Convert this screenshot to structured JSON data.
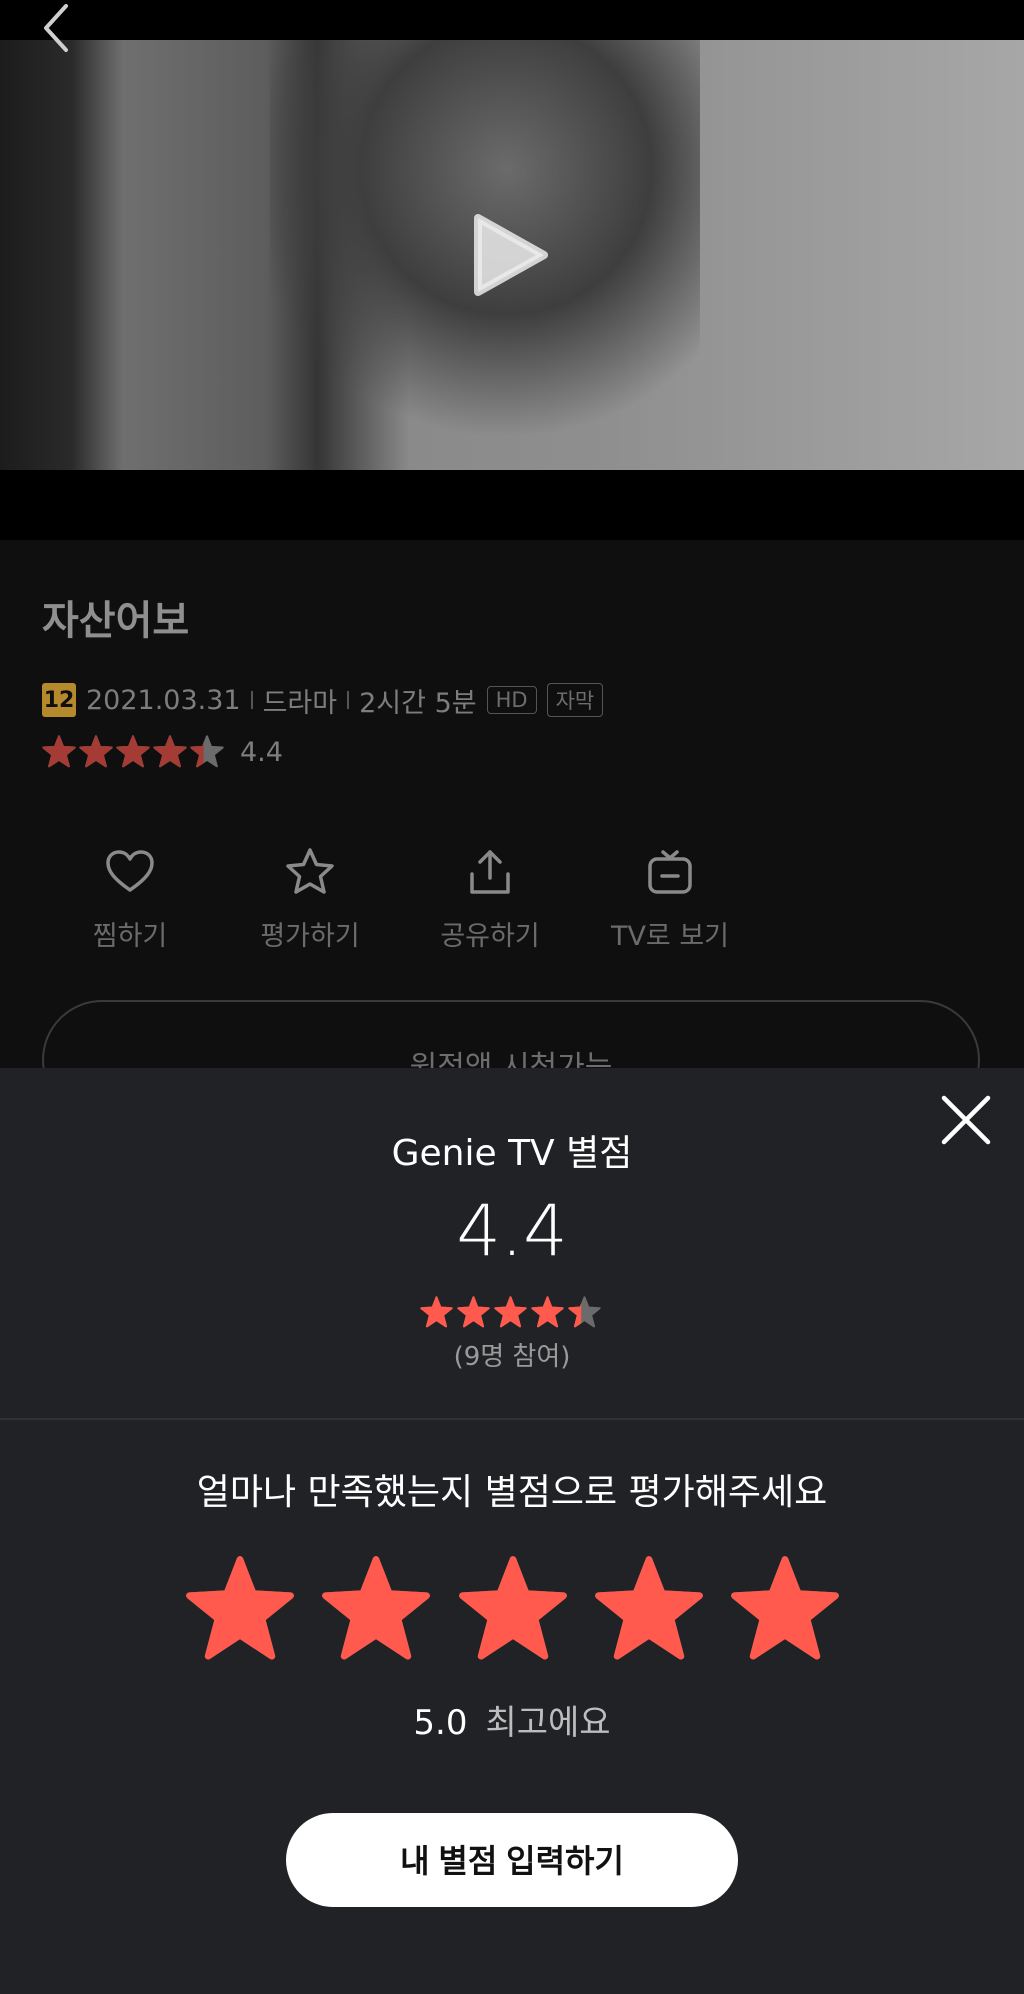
{
  "movie": {
    "title": "자산어보",
    "age_rating": "12",
    "release_date": "2021.03.31",
    "genre": "드라마",
    "runtime": "2시간 5분",
    "tags": [
      "HD",
      "자막"
    ],
    "rating": "4.4",
    "rating_value": 4.4
  },
  "actions": [
    {
      "label": "찜하기",
      "icon": "heart-icon"
    },
    {
      "label": "평가하기",
      "icon": "star-outline-icon"
    },
    {
      "label": "공유하기",
      "icon": "share-icon"
    },
    {
      "label": "TV로 보기",
      "icon": "tv-icon"
    }
  ],
  "purchase_button": {
    "label": "원정액 시청가능"
  },
  "sheet": {
    "title": "Genie TV 별점",
    "average": "4.4",
    "average_value": 4.4,
    "participants": "(9명 참여)",
    "prompt": "얼마나 만족했는지 별점으로 평가해주세요",
    "selected_score": "5.0",
    "selected_value": 5,
    "score_desc": "최고에요",
    "submit_label": "내 별점 입력하기"
  },
  "colors": {
    "star_active": "#ff5a4d",
    "star_inactive": "#6b6b6b",
    "rating_star_dim": "#a43c35",
    "sheet_bg": "#202226",
    "page_bg": "#0f0f10"
  }
}
